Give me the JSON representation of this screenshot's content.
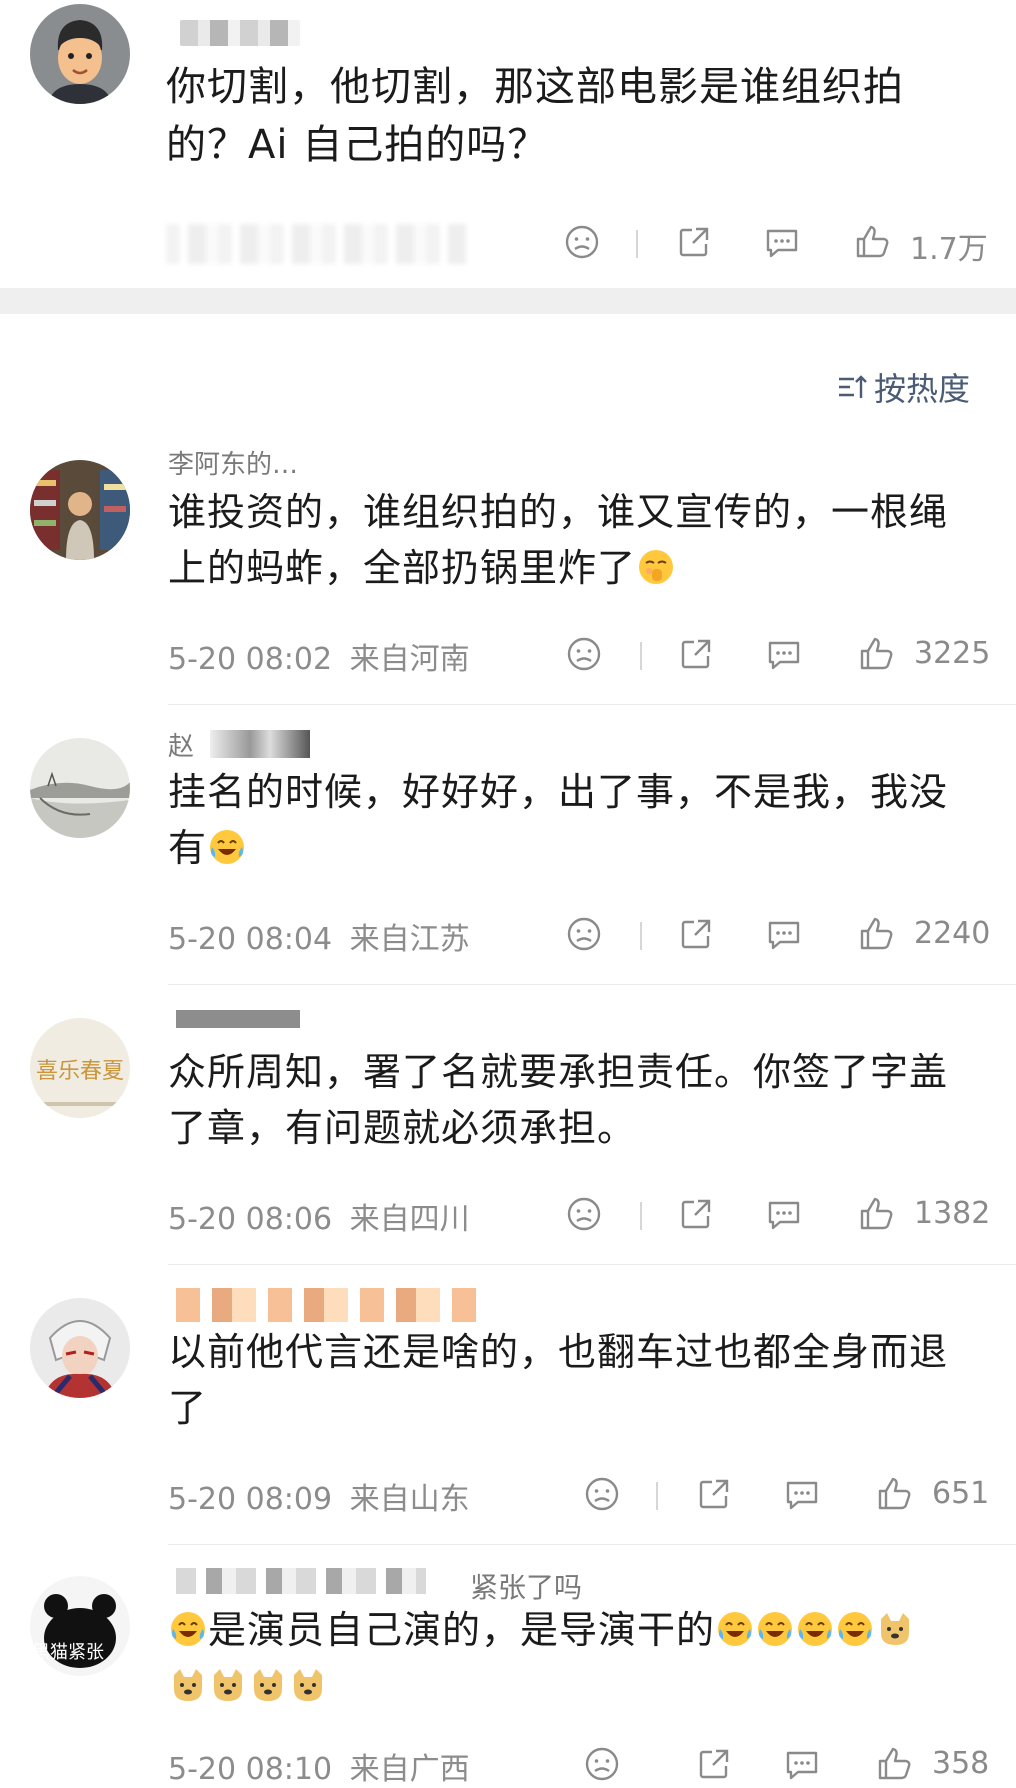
{
  "post": {
    "text": "你切割，他切割，那这部电影是谁组织拍的？Ai 自己拍的吗？",
    "like_count": "1.7万",
    "avatar_icon": "cartoon-man-avatar"
  },
  "sort": {
    "label": "按热度",
    "icon": "sort-icon"
  },
  "comments": [
    {
      "name": "李阿东的…",
      "text": "谁投资的，谁组织拍的，谁又宣传的，一根绳上的蚂蚱，全部扔锅里炸了",
      "emoji_tail": [
        "shush-face"
      ],
      "time": "5-20 08:02",
      "location": "来自河南",
      "likes": "3225"
    },
    {
      "name": "赵",
      "text": "挂名的时候，好好好，出了事，不是我，我没有",
      "emoji_tail": [
        "laugh-cry"
      ],
      "time": "5-20 08:04",
      "location": "来自江苏",
      "likes": "2240"
    },
    {
      "name": "",
      "text": "众所周知，署了名就要承担责任。你签了字盖了章，有问题就必须承担。",
      "emoji_tail": [],
      "time": "5-20 08:06",
      "location": "来自四川",
      "likes": "1382"
    },
    {
      "name": "",
      "text": "以前他代言还是啥的，也翻车过也都全身而退了",
      "emoji_tail": [],
      "time": "5-20 08:09",
      "location": "来自山东",
      "likes": "651"
    },
    {
      "name": "紧张了吗",
      "text": "是演员自己演的，是导演干的",
      "emoji_head": [
        "laugh-cry"
      ],
      "emoji_tail": [
        "laugh-cry",
        "laugh-cry",
        "laugh-cry",
        "laugh-cry",
        "doge",
        "doge",
        "doge",
        "doge",
        "doge"
      ],
      "avatar_text": "黑猫紧张",
      "time": "5-20 08:10",
      "location": "来自广西",
      "likes": "358"
    }
  ],
  "colors": {
    "text": "#1b1b1b",
    "meta": "#8c8c8c",
    "sort": "#4a5b74",
    "band": "#efefef"
  }
}
